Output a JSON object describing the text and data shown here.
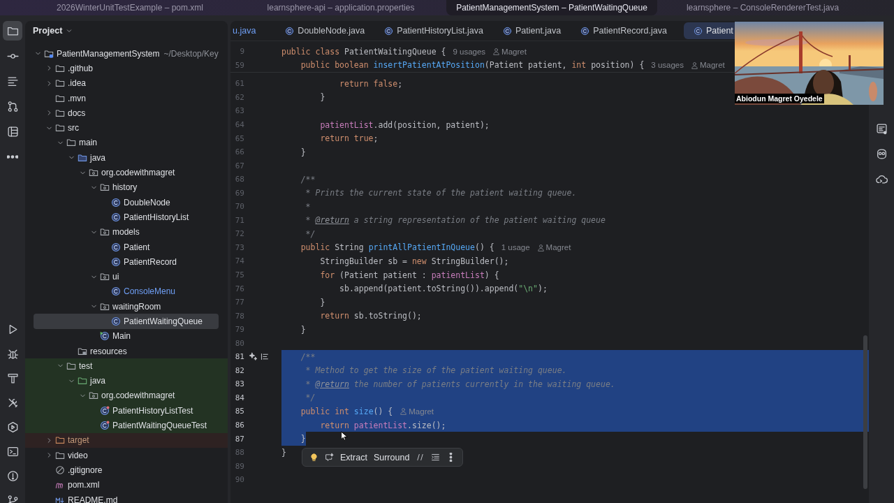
{
  "window_tabs": [
    {
      "label": "2026WinterUnitTestExample – pom.xml",
      "selected": false
    },
    {
      "label": "learnsphere-api – application.properties",
      "selected": false
    },
    {
      "label": "PatientManagementSystem – PatientWaitingQueue",
      "selected": true
    },
    {
      "label": "learnsphere – ConsoleRendererTest.java",
      "selected": false
    }
  ],
  "tool_strip_left": {
    "top": [
      {
        "kind": "folder",
        "selected": true
      },
      {
        "kind": "commit",
        "selected": false
      },
      {
        "kind": "structure",
        "selected": false
      },
      {
        "kind": "pull-request",
        "selected": false
      },
      {
        "kind": "layout",
        "selected": false
      },
      {
        "kind": "more",
        "selected": false
      }
    ],
    "bottom": [
      {
        "kind": "run",
        "selected": false
      },
      {
        "kind": "debug",
        "selected": false
      },
      {
        "kind": "build",
        "selected": false
      },
      {
        "kind": "tools",
        "selected": false
      },
      {
        "kind": "services",
        "selected": false
      },
      {
        "kind": "terminal",
        "selected": false
      },
      {
        "kind": "problems",
        "selected": false
      },
      {
        "kind": "git",
        "selected": false
      }
    ]
  },
  "project_panel": {
    "title": "Project",
    "tree": [
      {
        "label": "PatientManagementSystem",
        "path": "~/Desktop/Key",
        "kind": "module",
        "expanded": true,
        "selected": false,
        "children": [
          {
            "label": ".github",
            "kind": "folder",
            "expanded": false,
            "selected": false
          },
          {
            "label": ".idea",
            "kind": "folder",
            "expanded": false,
            "selected": false
          },
          {
            "label": ".mvn",
            "kind": "folder",
            "selected": false
          },
          {
            "label": "docs",
            "kind": "folder",
            "expanded": false,
            "selected": false
          },
          {
            "label": "src",
            "kind": "folder",
            "expanded": true,
            "selected": false,
            "children": [
              {
                "label": "main",
                "kind": "folder",
                "expanded": true,
                "selected": false,
                "children": [
                  {
                    "label": "java",
                    "kind": "source",
                    "expanded": true,
                    "selected": false,
                    "children": [
                      {
                        "label": "org.codewithmagret",
                        "kind": "package",
                        "expanded": true,
                        "selected": false,
                        "children": [
                          {
                            "label": "history",
                            "kind": "package",
                            "expanded": true,
                            "selected": false,
                            "children": [
                              {
                                "label": "DoubleNode",
                                "kind": "class",
                                "selected": false
                              },
                              {
                                "label": "PatientHistoryList",
                                "kind": "class",
                                "selected": false
                              }
                            ]
                          },
                          {
                            "label": "models",
                            "kind": "package",
                            "expanded": true,
                            "selected": false,
                            "children": [
                              {
                                "label": "Patient",
                                "kind": "class",
                                "selected": false
                              },
                              {
                                "label": "PatientRecord",
                                "kind": "class",
                                "selected": false
                              }
                            ]
                          },
                          {
                            "label": "ui",
                            "kind": "package",
                            "expanded": true,
                            "selected": false,
                            "children": [
                              {
                                "label": "ConsoleMenu",
                                "kind": "class",
                                "modified": true,
                                "selected": false
                              }
                            ]
                          },
                          {
                            "label": "waitingRoom",
                            "kind": "package",
                            "expanded": true,
                            "selected": false,
                            "children": [
                              {
                                "label": "PatientWaitingQueue",
                                "kind": "class",
                                "selected": true
                              }
                            ]
                          },
                          {
                            "label": "Main",
                            "kind": "main-class",
                            "selected": false
                          }
                        ]
                      }
                    ]
                  },
                  {
                    "label": "resources",
                    "kind": "resources",
                    "selected": false
                  }
                ]
              },
              {
                "label": "test",
                "kind": "folder",
                "expanded": true,
                "test_sources": true,
                "selected": false,
                "children": [
                  {
                    "label": "java",
                    "kind": "test-source",
                    "expanded": true,
                    "test_sources": true,
                    "selected": false,
                    "children": [
                      {
                        "label": "org.codewithmagret",
                        "kind": "package",
                        "expanded": true,
                        "test_sources": true,
                        "selected": false,
                        "children": [
                          {
                            "label": "PatientHistoryListTest",
                            "kind": "test-class",
                            "test_sources": true,
                            "selected": false
                          },
                          {
                            "label": "PatientWaitingQueueTest",
                            "kind": "test-class",
                            "test_sources": true,
                            "selected": false
                          }
                        ]
                      }
                    ]
                  }
                ]
              }
            ]
          },
          {
            "label": "target",
            "kind": "excluded",
            "expanded": false,
            "excluded": true,
            "selected": false
          },
          {
            "label": "video",
            "kind": "folder",
            "expanded": false,
            "selected": false
          },
          {
            "label": ".gitignore",
            "kind": "ignore",
            "selected": false
          },
          {
            "label": "pom.xml",
            "kind": "maven",
            "selected": false
          },
          {
            "label": "README.md",
            "kind": "markdown",
            "selected": false
          }
        ]
      }
    ]
  },
  "editor_tabs": [
    {
      "label": "u.java",
      "kind": "cut",
      "selected": false
    },
    {
      "label": "DoubleNode.java",
      "kind": "class",
      "selected": false
    },
    {
      "label": "PatientHistoryList.java",
      "kind": "class",
      "selected": false
    },
    {
      "label": "Patient.java",
      "kind": "class",
      "selected": false
    },
    {
      "label": "PatientRecord.java",
      "kind": "class",
      "selected": false
    },
    {
      "label": "Patient",
      "kind": "class",
      "selected": true
    }
  ],
  "sticky_lines": [
    {
      "number": "9",
      "tokens": [
        {
          "kind": "kw",
          "text": "public class "
        },
        {
          "kind": "plain",
          "text": "PatientWaitingQueue {"
        }
      ],
      "usages": "9 usages",
      "author": "Magret"
    },
    {
      "number": "59",
      "tokens": [
        {
          "kind": "kw",
          "text": "    public boolean "
        },
        {
          "kind": "fn",
          "text": "insertPatientAtPosition"
        },
        {
          "kind": "plain",
          "text": "(Patient patient, "
        },
        {
          "kind": "kw",
          "text": "int"
        },
        {
          "kind": "plain",
          "text": " position) {"
        }
      ],
      "usages": "3 usages",
      "author": "Magret"
    }
  ],
  "lines": [
    {
      "number": "61",
      "selected": false,
      "tokens": [
        {
          "kind": "kw",
          "text": "            return false"
        },
        {
          "kind": "plain",
          "text": ";"
        }
      ]
    },
    {
      "number": "62",
      "selected": false,
      "tokens": [
        {
          "kind": "plain",
          "text": "        }"
        }
      ]
    },
    {
      "number": "63",
      "selected": false
    },
    {
      "number": "64",
      "selected": false,
      "tokens": [
        {
          "kind": "field",
          "text": "        patientList"
        },
        {
          "kind": "plain",
          "text": ".add(position, patient);"
        }
      ]
    },
    {
      "number": "65",
      "selected": false,
      "tokens": [
        {
          "kind": "kw",
          "text": "        return true"
        },
        {
          "kind": "plain",
          "text": ";"
        }
      ]
    },
    {
      "number": "66",
      "selected": false,
      "tokens": [
        {
          "kind": "plain",
          "text": "    }"
        }
      ]
    },
    {
      "number": "67",
      "selected": false
    },
    {
      "number": "68",
      "selected": false,
      "tokens": [
        {
          "kind": "comment",
          "text": "    /**"
        }
      ]
    },
    {
      "number": "69",
      "selected": false,
      "tokens": [
        {
          "kind": "comment",
          "text": "     * Prints the current state of the patient waiting queue."
        }
      ]
    },
    {
      "number": "70",
      "selected": false,
      "tokens": [
        {
          "kind": "comment",
          "text": "     *"
        }
      ]
    },
    {
      "number": "71",
      "selected": false,
      "tokens": [
        {
          "kind": "comment",
          "text": "     * "
        },
        {
          "kind": "doctag",
          "text": "@return"
        },
        {
          "kind": "comment",
          "text": " a string representation of the patient waiting queue"
        }
      ]
    },
    {
      "number": "72",
      "selected": false,
      "tokens": [
        {
          "kind": "comment",
          "text": "     */"
        }
      ]
    },
    {
      "number": "73",
      "selected": false,
      "tokens": [
        {
          "kind": "kw",
          "text": "    public "
        },
        {
          "kind": "plain",
          "text": "String "
        },
        {
          "kind": "fn",
          "text": "printAllPatientInQueue"
        },
        {
          "kind": "plain",
          "text": "() {"
        }
      ],
      "usages": "1 usage",
      "author": "Magret"
    },
    {
      "number": "74",
      "selected": false,
      "tokens": [
        {
          "kind": "plain",
          "text": "        StringBuilder sb = "
        },
        {
          "kind": "kw",
          "text": "new"
        },
        {
          "kind": "plain",
          "text": " StringBuilder();"
        }
      ]
    },
    {
      "number": "75",
      "selected": false,
      "tokens": [
        {
          "kind": "kw",
          "text": "        for"
        },
        {
          "kind": "plain",
          "text": " (Patient patient : "
        },
        {
          "kind": "field",
          "text": "patientList"
        },
        {
          "kind": "plain",
          "text": ") {"
        }
      ]
    },
    {
      "number": "76",
      "selected": false,
      "tokens": [
        {
          "kind": "plain",
          "text": "            sb.append(patient.toString()).append("
        },
        {
          "kind": "string",
          "text": "\"\\n\""
        },
        {
          "kind": "plain",
          "text": ");"
        }
      ]
    },
    {
      "number": "77",
      "selected": false,
      "tokens": [
        {
          "kind": "plain",
          "text": "        }"
        }
      ]
    },
    {
      "number": "78",
      "selected": false,
      "tokens": [
        {
          "kind": "kw",
          "text": "        return"
        },
        {
          "kind": "plain",
          "text": " sb.toString();"
        }
      ]
    },
    {
      "number": "79",
      "selected": false,
      "tokens": [
        {
          "kind": "plain",
          "text": "    }"
        }
      ]
    },
    {
      "number": "80",
      "selected": false
    },
    {
      "number": "81",
      "selected": true,
      "gutter_actions": true,
      "tokens": [
        {
          "kind": "comment",
          "text": "    /**"
        }
      ]
    },
    {
      "number": "82",
      "selected": true,
      "tokens": [
        {
          "kind": "comment",
          "text": "     * Method to get the size of the patient waiting queue."
        }
      ]
    },
    {
      "number": "83",
      "selected": true,
      "tokens": [
        {
          "kind": "comment",
          "text": "     * "
        },
        {
          "kind": "doctag",
          "text": "@return"
        },
        {
          "kind": "comment",
          "text": " the number of patients currently in the waiting queue."
        }
      ]
    },
    {
      "number": "84",
      "selected": true,
      "tokens": [
        {
          "kind": "comment",
          "text": "     */"
        }
      ]
    },
    {
      "number": "85",
      "selected": true,
      "tokens": [
        {
          "kind": "kw",
          "text": "    public int "
        },
        {
          "kind": "fn",
          "text": "size"
        },
        {
          "kind": "plain",
          "text": "() {"
        }
      ],
      "author": "Magret"
    },
    {
      "number": "86",
      "selected": true,
      "tokens": [
        {
          "kind": "kw",
          "text": "        return "
        },
        {
          "kind": "field",
          "text": "patientList"
        },
        {
          "kind": "plain",
          "text": ".size();"
        }
      ]
    },
    {
      "number": "87",
      "selected": true,
      "tokens": [
        {
          "kind": "plain",
          "text": "    }"
        }
      ]
    },
    {
      "number": "88",
      "selected": false,
      "tokens": [
        {
          "kind": "plain",
          "text": "}"
        }
      ]
    },
    {
      "number": "89",
      "selected": false
    },
    {
      "number": "90",
      "selected": false
    }
  ],
  "floating_toolbar": {
    "actions": [
      "Extract",
      "Surround"
    ]
  },
  "video_overlay": {
    "kind": "picture",
    "name": "Abiodun Magret Oyedele"
  },
  "tool_strip_right": [
    {
      "kind": "notes"
    },
    {
      "kind": "robot"
    },
    {
      "kind": "cloud-terminal"
    }
  ]
}
